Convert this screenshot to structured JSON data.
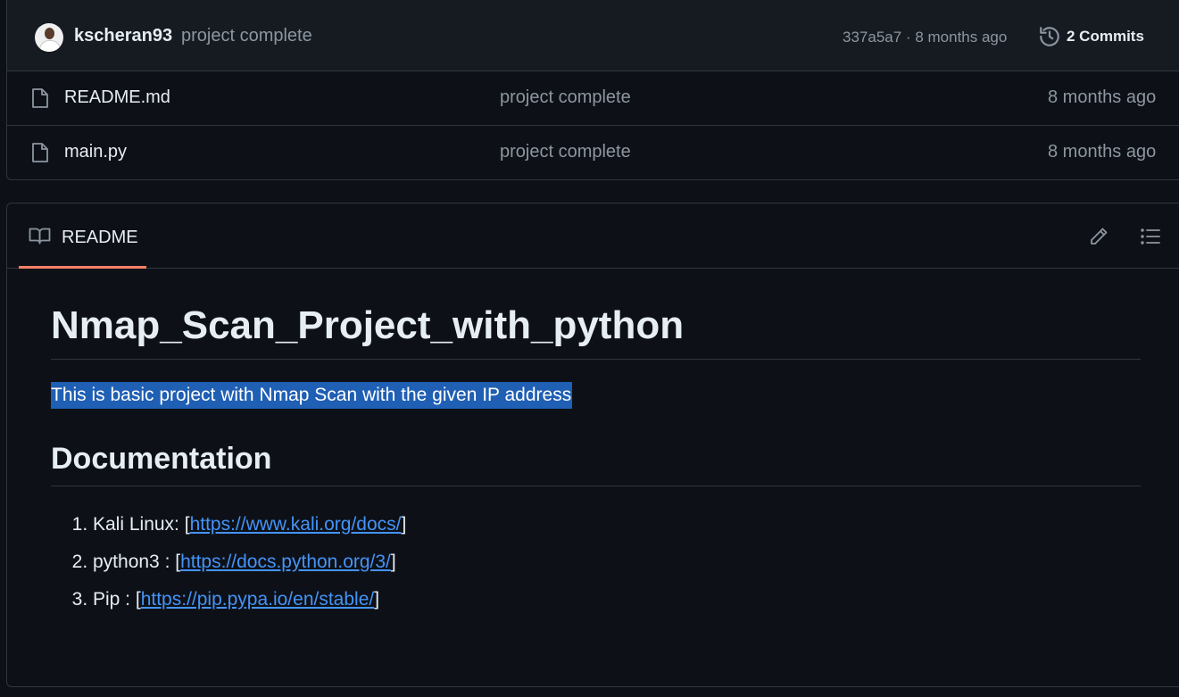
{
  "commit_bar": {
    "author": "kscheran93",
    "message": "project complete",
    "sha": "337a5a7",
    "separator": "·",
    "age": "8 months ago",
    "commits_label": "2 Commits"
  },
  "files": [
    {
      "name": "README.md",
      "message": "project complete",
      "age": "8 months ago"
    },
    {
      "name": "main.py",
      "message": "project complete",
      "age": "8 months ago"
    }
  ],
  "readme": {
    "tab_label": "README",
    "title": "Nmap_Scan_Project_with_python",
    "intro": "This is basic project with Nmap Scan with the given IP address",
    "section_heading": "Documentation",
    "docs": [
      {
        "prefix": "Kali Linux: [",
        "url": "https://www.kali.org/docs/",
        "suffix": "]"
      },
      {
        "prefix": "python3 : [",
        "url": "https://docs.python.org/3/",
        "suffix": "]"
      },
      {
        "prefix": "Pip : [",
        "url": "https://pip.pypa.io/en/stable/",
        "suffix": "]"
      }
    ]
  },
  "icons": {
    "file": "file-icon",
    "history": "history-icon",
    "book": "book-icon",
    "edit": "pencil-icon",
    "outline": "list-unordered-icon"
  },
  "colors": {
    "background": "#0d1117",
    "header_bg": "#161b22",
    "border": "#30363d",
    "muted_text": "#8d96a0",
    "link": "#4493f8",
    "tab_underline": "#f78166",
    "selection": "#1f5fb4"
  }
}
